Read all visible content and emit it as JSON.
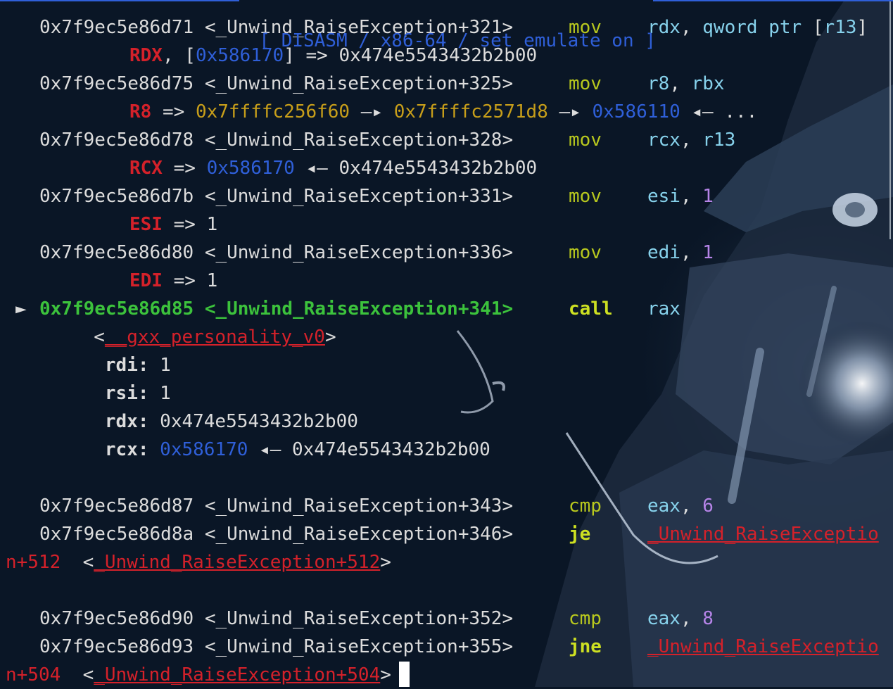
{
  "header": {
    "title": "[ DISASM / x86-64 / set emulate on ]"
  },
  "lines": [
    {
      "addr": "0x7f9ec5e86d71",
      "sym": "<_Unwind_RaiseException+321>",
      "mnem": "mov",
      "ops": [
        {
          "t": "rdx",
          "c": "c"
        },
        {
          "t": ", ",
          "c": "w"
        },
        {
          "t": "qword ptr ",
          "c": "c"
        },
        {
          "t": "[",
          "c": "w"
        },
        {
          "t": "r13",
          "c": "c"
        },
        {
          "t": "]",
          "c": "w"
        }
      ]
    },
    {
      "detail": [
        {
          "t": "RDX",
          "c": "rb"
        },
        {
          "t": ", [",
          "c": "w"
        },
        {
          "t": "0x586170",
          "c": "b"
        },
        {
          "t": "] => 0x474e5543432b2b00",
          "c": "w"
        }
      ]
    },
    {
      "addr": "0x7f9ec5e86d75",
      "sym": "<_Unwind_RaiseException+325>",
      "mnem": "mov",
      "ops": [
        {
          "t": "r8",
          "c": "c"
        },
        {
          "t": ", ",
          "c": "w"
        },
        {
          "t": "rbx",
          "c": "c"
        }
      ]
    },
    {
      "detail": [
        {
          "t": "R8",
          "c": "rb"
        },
        {
          "t": " => ",
          "c": "w"
        },
        {
          "t": "0x7ffffc256f60",
          "c": "y"
        },
        {
          "t": " —▸ ",
          "c": "w"
        },
        {
          "t": "0x7ffffc2571d8",
          "c": "y"
        },
        {
          "t": " —▸ ",
          "c": "w"
        },
        {
          "t": "0x586110",
          "c": "b"
        },
        {
          "t": " ◂— ...",
          "c": "w"
        }
      ]
    },
    {
      "addr": "0x7f9ec5e86d78",
      "sym": "<_Unwind_RaiseException+328>",
      "mnem": "mov",
      "ops": [
        {
          "t": "rcx",
          "c": "c"
        },
        {
          "t": ", ",
          "c": "w"
        },
        {
          "t": "r13",
          "c": "c"
        }
      ]
    },
    {
      "detail": [
        {
          "t": "RCX",
          "c": "rb"
        },
        {
          "t": " => ",
          "c": "w"
        },
        {
          "t": "0x586170",
          "c": "b"
        },
        {
          "t": " ◂— 0x474e5543432b2b00",
          "c": "w"
        }
      ]
    },
    {
      "addr": "0x7f9ec5e86d7b",
      "sym": "<_Unwind_RaiseException+331>",
      "mnem": "mov",
      "ops": [
        {
          "t": "esi",
          "c": "c"
        },
        {
          "t": ", ",
          "c": "w"
        },
        {
          "t": "1",
          "c": "m"
        }
      ]
    },
    {
      "detail": [
        {
          "t": "ESI",
          "c": "rb"
        },
        {
          "t": " => 1",
          "c": "w"
        }
      ]
    },
    {
      "addr": "0x7f9ec5e86d80",
      "sym": "<_Unwind_RaiseException+336>",
      "mnem": "mov",
      "ops": [
        {
          "t": "edi",
          "c": "c"
        },
        {
          "t": ", ",
          "c": "w"
        },
        {
          "t": "1",
          "c": "m"
        }
      ]
    },
    {
      "detail": [
        {
          "t": "EDI",
          "c": "rb"
        },
        {
          "t": " => 1",
          "c": "w"
        }
      ]
    },
    {
      "current": true,
      "marker": "►",
      "addr": "0x7f9ec5e86d85",
      "sym": "<_Unwind_RaiseException+341>",
      "mnem": "call",
      "ops": [
        {
          "t": "rax",
          "c": "c"
        }
      ]
    },
    {
      "raw": [
        {
          "t": "        <",
          "c": "w"
        },
        {
          "t": "__gxx_personality_v0",
          "c": "r u"
        },
        {
          "t": ">",
          "c": "w"
        }
      ]
    },
    {
      "raw": [
        {
          "t": "         ",
          "c": "w"
        },
        {
          "t": "rdi:",
          "c": "w bold"
        },
        {
          "t": " 1",
          "c": "w"
        }
      ]
    },
    {
      "raw": [
        {
          "t": "         ",
          "c": "w"
        },
        {
          "t": "rsi:",
          "c": "w bold"
        },
        {
          "t": " 1",
          "c": "w"
        }
      ]
    },
    {
      "raw": [
        {
          "t": "         ",
          "c": "w"
        },
        {
          "t": "rdx:",
          "c": "w bold"
        },
        {
          "t": " 0x474e5543432b2b00",
          "c": "w"
        }
      ]
    },
    {
      "raw": [
        {
          "t": "         ",
          "c": "w"
        },
        {
          "t": "rcx:",
          "c": "w bold"
        },
        {
          "t": " ",
          "c": "w"
        },
        {
          "t": "0x586170",
          "c": "b"
        },
        {
          "t": " ◂— 0x474e5543432b2b00",
          "c": "w"
        }
      ]
    },
    {
      "blank": true
    },
    {
      "addr": "0x7f9ec5e86d87",
      "sym": "<_Unwind_RaiseException+343>",
      "mnem": "cmp",
      "ops": [
        {
          "t": "eax",
          "c": "c"
        },
        {
          "t": ", ",
          "c": "w"
        },
        {
          "t": "6",
          "c": "m"
        }
      ]
    },
    {
      "addr": "0x7f9ec5e86d8a",
      "sym": "<_Unwind_RaiseException+346>",
      "mnem": "je",
      "mnemBold": true,
      "ops": [
        {
          "t": "_Unwind_RaiseExceptio",
          "c": "r u"
        }
      ]
    },
    {
      "raw": [
        {
          "t": "n+512",
          "c": "r"
        },
        {
          "t": "  <",
          "c": "w"
        },
        {
          "t": "_Unwind_RaiseException+512",
          "c": "r u"
        },
        {
          "t": ">",
          "c": "w"
        }
      ]
    },
    {
      "blank": true
    },
    {
      "addr": "0x7f9ec5e86d90",
      "sym": "<_Unwind_RaiseException+352>",
      "mnem": "cmp",
      "ops": [
        {
          "t": "eax",
          "c": "c"
        },
        {
          "t": ", ",
          "c": "w"
        },
        {
          "t": "8",
          "c": "m"
        }
      ]
    },
    {
      "addr": "0x7f9ec5e86d93",
      "sym": "<_Unwind_RaiseException+355>",
      "mnem": "jne",
      "mnemBold": true,
      "ops": [
        {
          "t": "_Unwind_RaiseExceptio",
          "c": "r u"
        }
      ]
    },
    {
      "raw": [
        {
          "t": "n+504",
          "c": "r"
        },
        {
          "t": "  <",
          "c": "w"
        },
        {
          "t": "_Unwind_RaiseException+504",
          "c": "r u"
        },
        {
          "t": ">",
          "c": "w"
        }
      ]
    }
  ]
}
